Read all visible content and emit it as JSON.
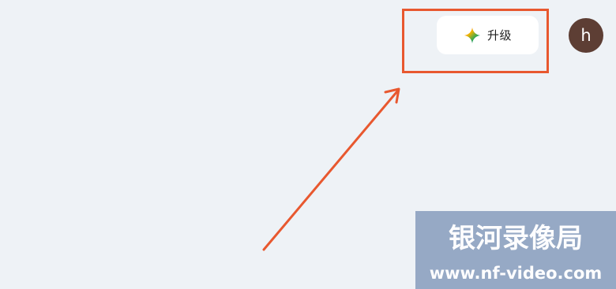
{
  "header": {
    "upgrade": {
      "label": "升级",
      "icon": "gemini-sparkle-icon"
    },
    "avatar": {
      "initial": "h",
      "color": "#5d3e34"
    }
  },
  "annotation": {
    "color": "#e8582f"
  },
  "watermark": {
    "title": "银河录像局",
    "url": "www.nf-video.com",
    "background": "#8fa3c1"
  },
  "colors": {
    "page_background": "#eef2f6"
  }
}
